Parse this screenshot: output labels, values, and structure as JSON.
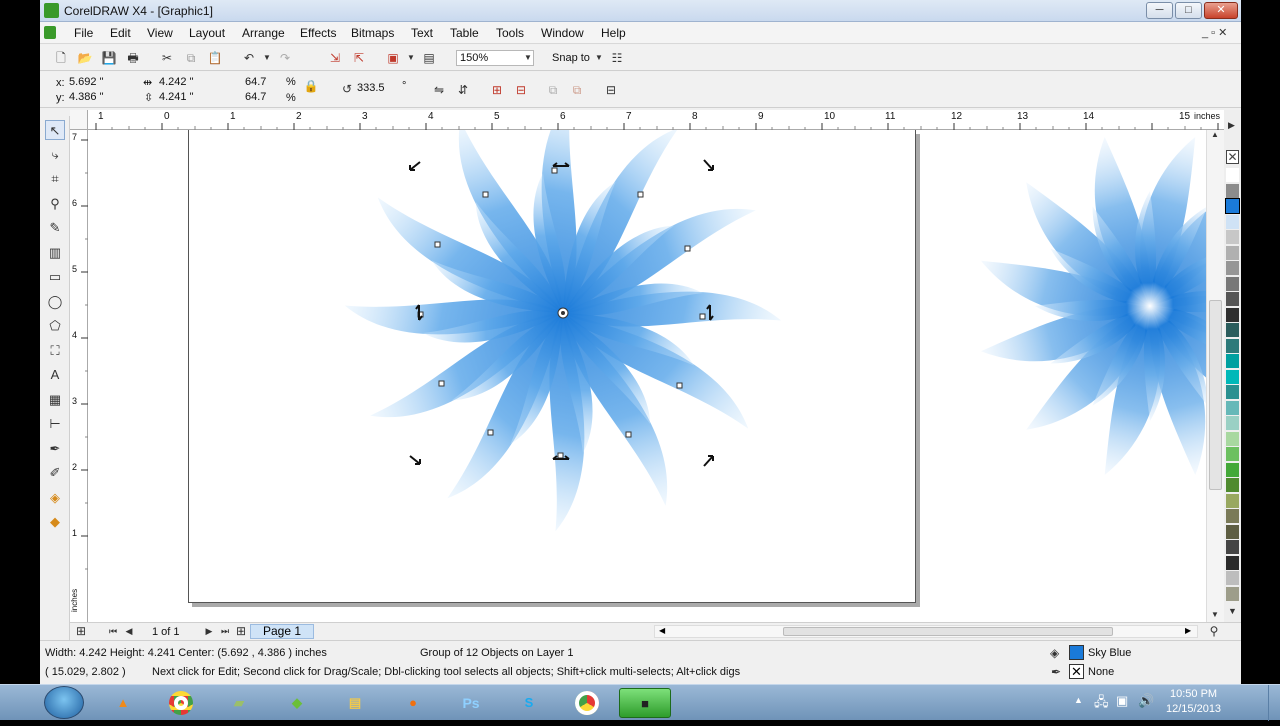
{
  "window": {
    "title": "CorelDRAW X4 - [Graphic1]",
    "min": "─",
    "max": "□",
    "close": "✕"
  },
  "menu": [
    "File",
    "Edit",
    "View",
    "Layout",
    "Arrange",
    "Effects",
    "Bitmaps",
    "Text",
    "Table",
    "Tools",
    "Window",
    "Help"
  ],
  "toolbar": {
    "zoom": "150%",
    "snap_to": "Snap to"
  },
  "property_bar": {
    "x_label": "x:",
    "x": "5.692 \"",
    "y_label": "y:",
    "y": "4.386 \"",
    "width": "4.242 \"",
    "height": "4.241 \"",
    "scale_x": "64.7",
    "scale_y": "64.7",
    "percent": "%",
    "rotation": "333.5",
    "degree": "°"
  },
  "rulers": {
    "h_ticks": [
      "1",
      "0",
      "1",
      "2",
      "3",
      "4",
      "5",
      "6",
      "7",
      "8",
      "9",
      "10",
      "11",
      "12",
      "13",
      "14",
      "15"
    ],
    "unit": "inches",
    "v_ticks": [
      "7",
      "6",
      "5",
      "4",
      "3",
      "2",
      "1"
    ],
    "v_unit": "inches"
  },
  "page_nav": {
    "count": "1 of 1",
    "tab": "Page 1"
  },
  "status": {
    "dimensions": "Width: 4.242  Height: 4.241  Center: (5.692 , 4.386 )  inches",
    "selection": "Group of 12 Objects on Layer 1",
    "cursor": "( 15.029, 2.802 )",
    "hint": "Next click for Edit; Second click for Drag/Scale; Dbl-clicking tool selects all objects; Shift+click multi-selects; Alt+click digs",
    "fill_name": "Sky Blue",
    "outline_name": "None"
  },
  "colors": {
    "fill": "#1a7ad9",
    "page_bg": "#ffffff",
    "petal_light": "#cfe6fb",
    "petal_dark": "#1a7ad9"
  },
  "palette": [
    "#ffffff",
    "#8c8c8c",
    "#1a7ad9",
    "#cfe2f5",
    "#c7c7c7",
    "#b0b0b0",
    "#969696",
    "#787878",
    "#555555",
    "#2f2f2f",
    "#2b5d5d",
    "#2d7a7a",
    "#00a0a0",
    "#00b8b8",
    "#2a9090",
    "#66b8b8",
    "#9ad0c4",
    "#a8d8a0",
    "#6cc060",
    "#43a838",
    "#4f8a2f",
    "#98a860",
    "#7a7a58",
    "#5d5d42",
    "#444444",
    "#2a2a2a",
    "#bdbdbd",
    "#9d9d8a"
  ],
  "tray": {
    "time": "10:50 PM",
    "date": "12/15/2013"
  },
  "taskbar": {
    "ps": "Ps"
  }
}
